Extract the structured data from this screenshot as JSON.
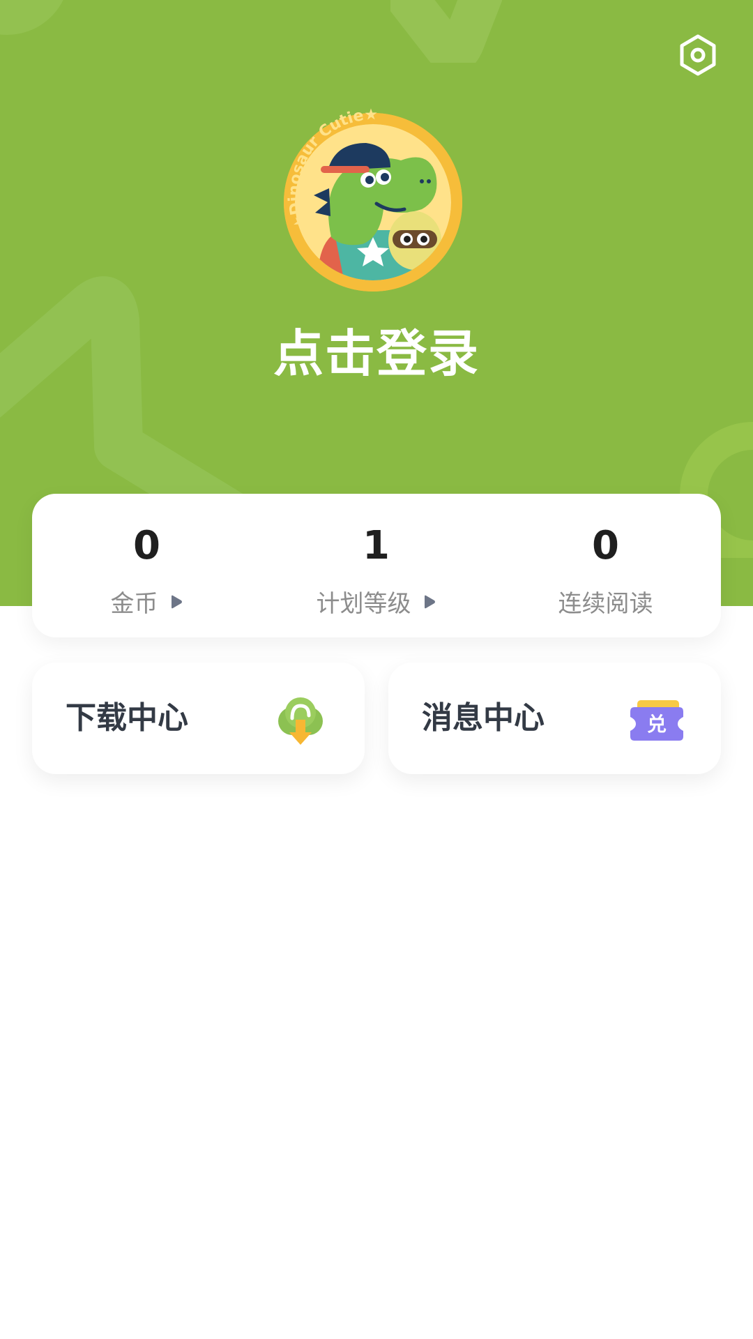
{
  "header": {
    "login_text": "点击登录",
    "background_color": "#8aba43",
    "settings_icon": "gear-icon",
    "avatar_icon": "dinosaur-avatar"
  },
  "stats": [
    {
      "value": "0",
      "label": "金币",
      "has_arrow": true
    },
    {
      "value": "1",
      "label": "计划等级",
      "has_arrow": true
    },
    {
      "value": "0",
      "label": "连续阅读",
      "has_arrow": false
    }
  ],
  "tiles": [
    {
      "label": "下载中心",
      "icon": "cloud-download-icon"
    },
    {
      "label": "消息中心",
      "icon": "redeem-ticket-icon",
      "icon_text": "兑"
    }
  ],
  "colors": {
    "accent_green": "#8aba43",
    "ticket_purple": "#8a7cf0",
    "download_orange": "#f7b733"
  }
}
